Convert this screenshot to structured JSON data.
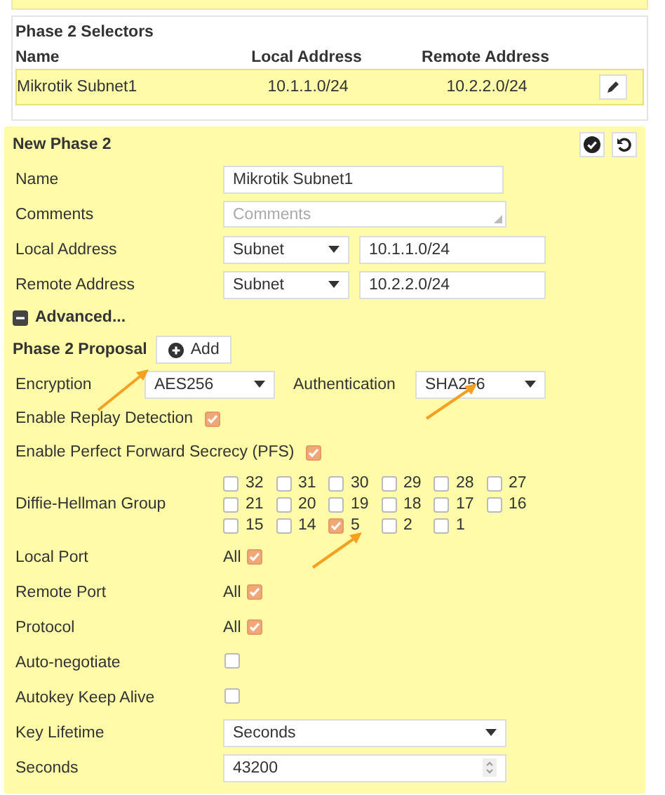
{
  "selectors": {
    "title": "Phase 2 Selectors",
    "columns": [
      "Name",
      "Local Address",
      "Remote Address"
    ],
    "rows": [
      {
        "cells": [
          "Mikrotik Subnet1",
          "10.1.1.0/24",
          "10.2.2.0/24"
        ],
        "selected": true
      }
    ]
  },
  "form": {
    "title": "New Phase 2",
    "fields": [
      {
        "kind": "text",
        "label": "Name",
        "value": "Mikrotik Subnet1"
      },
      {
        "kind": "textarea",
        "label": "Comments",
        "placeholder": "Comments"
      },
      {
        "kind": "address",
        "label": "Local Address",
        "type": "Subnet",
        "value": "10.1.1.0/24"
      },
      {
        "kind": "address",
        "label": "Remote Address",
        "type": "Subnet",
        "value": "10.2.2.0/24"
      },
      {
        "kind": "toggle",
        "label": "Advanced...",
        "expanded": true
      },
      {
        "kind": "proposal",
        "label": "Phase 2 Proposal",
        "button": "Add"
      },
      {
        "kind": "crypto",
        "label": "Encryption",
        "value": "AES256",
        "label2": "Authentication",
        "value2": "SHA256"
      },
      {
        "kind": "inline-check",
        "label": "Enable Replay Detection",
        "checked": true
      },
      {
        "kind": "inline-check",
        "label": "Enable Perfect Forward Secrecy (PFS)",
        "checked": true
      },
      {
        "kind": "groups",
        "label": "Diffie-Hellman Group",
        "options": [
          {
            "label": "32",
            "checked": false
          },
          {
            "label": "31",
            "checked": false
          },
          {
            "label": "30",
            "checked": false
          },
          {
            "label": "29",
            "checked": false
          },
          {
            "label": "28",
            "checked": false
          },
          {
            "label": "27",
            "checked": false
          },
          {
            "label": "21",
            "checked": false
          },
          {
            "label": "20",
            "checked": false
          },
          {
            "label": "19",
            "checked": false
          },
          {
            "label": "18",
            "checked": false
          },
          {
            "label": "17",
            "checked": false
          },
          {
            "label": "16",
            "checked": false
          },
          {
            "label": "15",
            "checked": false
          },
          {
            "label": "14",
            "checked": false
          },
          {
            "label": "5",
            "checked": true
          },
          {
            "label": "2",
            "checked": false
          },
          {
            "label": "1",
            "checked": false
          }
        ]
      },
      {
        "kind": "all-check",
        "label": "Local Port",
        "text": "All",
        "checked": true
      },
      {
        "kind": "all-check",
        "label": "Remote Port",
        "text": "All",
        "checked": true
      },
      {
        "kind": "all-check",
        "label": "Protocol",
        "text": "All",
        "checked": true
      },
      {
        "kind": "check",
        "label": "Auto-negotiate",
        "checked": false
      },
      {
        "kind": "check",
        "label": "Autokey Keep Alive",
        "checked": false
      },
      {
        "kind": "select",
        "label": "Key Lifetime",
        "value": "Seconds"
      },
      {
        "kind": "number",
        "label": "Seconds",
        "value": "43200"
      }
    ]
  }
}
